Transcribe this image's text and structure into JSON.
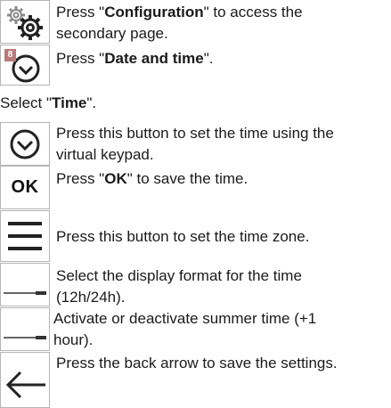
{
  "steps": [
    {
      "icon": "gear-icon",
      "pre": "Press \"",
      "bold": "Configuration",
      "post": "\" to access the",
      "line2": "secondary page."
    },
    {
      "icon": "clock-icon",
      "badge": "8",
      "pre": "Press \"",
      "bold": "Date and time",
      "post": "\"."
    },
    {
      "pre": "Select \"",
      "bold": "Time",
      "post": "\"."
    },
    {
      "icon": "chevron-down-circle-icon",
      "line1": "Press this button to set the time using the",
      "line2": "virtual keypad."
    },
    {
      "icon": "ok-icon",
      "icon_text": "OK",
      "pre": "Press \"",
      "bold": "OK",
      "post": "\" to save the time."
    },
    {
      "icon": "menu-icon",
      "line1": "Press this button to set the time zone."
    },
    {
      "icon": "toggle-icon",
      "line1": "Select the display format for the time",
      "line2": "(12h/24h)."
    },
    {
      "icon": "toggle-icon",
      "line1": "Activate or deactivate summer time (+1",
      "line2": "hour)."
    },
    {
      "icon": "back-arrow-icon",
      "line1": "Press the back arrow to save the settings."
    }
  ]
}
